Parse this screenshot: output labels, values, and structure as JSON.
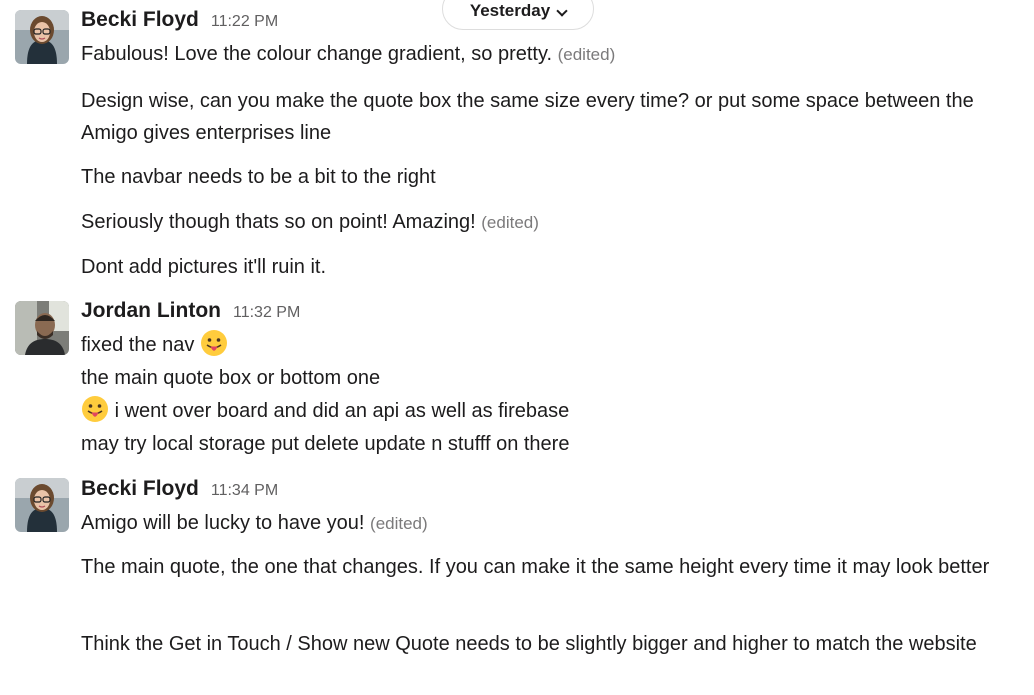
{
  "day_divider": {
    "label": "Yesterday",
    "icon": "chevron-down-icon"
  },
  "messages": [
    {
      "author": "Becki Floyd",
      "time": "11:22 PM",
      "lines": [
        {
          "text": "Fabulous! Love the colour change gradient, so pretty.",
          "edited": "(edited)"
        },
        {
          "text": "Design wise, can you make the quote box the same size every time? or put some space between the Amigo gives enterprises line"
        },
        {
          "text": "The navbar needs to be a bit to the right"
        },
        {
          "text": "Seriously though thats so on point! Amazing!",
          "edited": "(edited)"
        },
        {
          "text": "Dont add pictures it'll ruin it."
        }
      ]
    },
    {
      "author": "Jordan Linton",
      "time": "11:32 PM",
      "lines": [
        {
          "text": "fixed the nav",
          "emoji": "tongue-out-emoji"
        },
        {
          "text": "the main quote box or bottom one"
        },
        {
          "text": "i went over board and did an api as well as firebase",
          "emoji": "tongue-out-emoji"
        },
        {
          "text": "may try local storage put delete update n stufff on there"
        }
      ]
    },
    {
      "author": "Becki Floyd",
      "time": "11:34 PM",
      "lines": [
        {
          "text": "Amigo will be lucky to have you!",
          "edited": "(edited)"
        },
        {
          "text": "The main quote, the one that changes. If you can make it the same height every time it may look better"
        },
        {
          "text": "Think the Get in Touch / Show new Quote needs to be slightly bigger and higher to match the website"
        }
      ]
    }
  ]
}
